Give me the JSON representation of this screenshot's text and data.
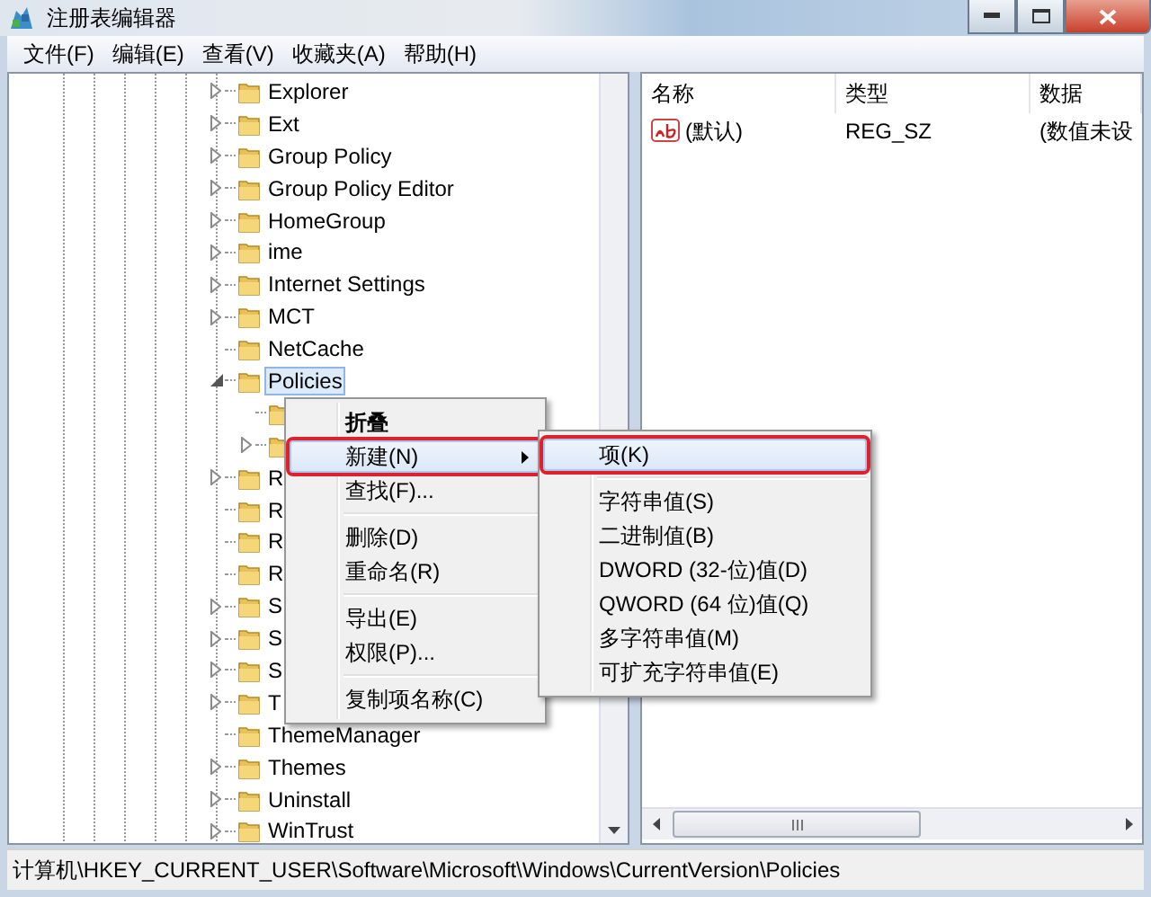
{
  "window": {
    "title": "注册表编辑器"
  },
  "menu_bar": [
    "文件(F)",
    "编辑(E)",
    "查看(V)",
    "收藏夹(A)",
    "帮助(H)"
  ],
  "tree": {
    "items": [
      {
        "label": "Explorer",
        "expandable": true,
        "selected": false
      },
      {
        "label": "Ext",
        "expandable": true,
        "selected": false
      },
      {
        "label": "Group Policy",
        "expandable": true,
        "selected": false
      },
      {
        "label": "Group Policy Editor",
        "expandable": true,
        "selected": false
      },
      {
        "label": "HomeGroup",
        "expandable": true,
        "selected": false
      },
      {
        "label": "ime",
        "expandable": true,
        "selected": false
      },
      {
        "label": "Internet Settings",
        "expandable": true,
        "selected": false
      },
      {
        "label": "MCT",
        "expandable": true,
        "selected": false
      },
      {
        "label": "NetCache",
        "expandable": false,
        "selected": false
      },
      {
        "label": "Policies",
        "expandable": true,
        "expanded": true,
        "selected": true,
        "children": [
          {
            "expandable": false
          },
          {
            "expandable": true
          }
        ]
      },
      {
        "label": "R",
        "expandable": true
      },
      {
        "label": "R",
        "expandable": false
      },
      {
        "label": "R",
        "expandable": false
      },
      {
        "label": "R",
        "expandable": false
      },
      {
        "label": "S",
        "expandable": true
      },
      {
        "label": "S",
        "expandable": true
      },
      {
        "label": "S",
        "expandable": true
      },
      {
        "label": "T",
        "expandable": true
      },
      {
        "label": "ThemeManager",
        "expandable": false,
        "selected": false
      },
      {
        "label": "Themes",
        "expandable": true,
        "selected": false
      },
      {
        "label": "Uninstall",
        "expandable": true,
        "selected": false
      },
      {
        "label": "WinTrust",
        "expandable": true,
        "selected": false
      }
    ]
  },
  "values": {
    "columns": [
      "名称",
      "类型",
      "数据"
    ],
    "rows": [
      {
        "name": "(默认)",
        "type": "REG_SZ",
        "data": "(数值未设"
      }
    ]
  },
  "context_menu": {
    "items": [
      {
        "kind": "item",
        "label": "折叠",
        "default": true,
        "highlighted": false,
        "marked": false
      },
      {
        "kind": "item",
        "label": "新建(N)",
        "submenu": true,
        "highlighted": true,
        "marked": true
      },
      {
        "kind": "item",
        "label": "查找(F)...",
        "highlighted": false,
        "marked": false
      },
      {
        "kind": "separator"
      },
      {
        "kind": "item",
        "label": "删除(D)",
        "highlighted": false,
        "marked": false
      },
      {
        "kind": "item",
        "label": "重命名(R)",
        "highlighted": false,
        "marked": false
      },
      {
        "kind": "separator"
      },
      {
        "kind": "item",
        "label": "导出(E)",
        "highlighted": false,
        "marked": false
      },
      {
        "kind": "item",
        "label": "权限(P)...",
        "highlighted": false,
        "marked": false
      },
      {
        "kind": "separator"
      },
      {
        "kind": "item",
        "label": "复制项名称(C)",
        "highlighted": false,
        "marked": false
      }
    ]
  },
  "submenu": {
    "items": [
      {
        "kind": "item",
        "label": "项(K)",
        "highlighted": true,
        "marked": true
      },
      {
        "kind": "separator"
      },
      {
        "kind": "item",
        "label": "字符串值(S)",
        "highlighted": false,
        "marked": false
      },
      {
        "kind": "item",
        "label": "二进制值(B)",
        "highlighted": false,
        "marked": false
      },
      {
        "kind": "item",
        "label": "DWORD (32-位)值(D)",
        "highlighted": false,
        "marked": false
      },
      {
        "kind": "item",
        "label": "QWORD (64 位)值(Q)",
        "highlighted": false,
        "marked": false
      },
      {
        "kind": "item",
        "label": "多字符串值(M)",
        "highlighted": false,
        "marked": false
      },
      {
        "kind": "item",
        "label": "可扩充字符串值(E)",
        "highlighted": false,
        "marked": false
      }
    ]
  },
  "status_bar": "计算机\\HKEY_CURRENT_USER\\Software\\Microsoft\\Windows\\CurrentVersion\\Policies"
}
